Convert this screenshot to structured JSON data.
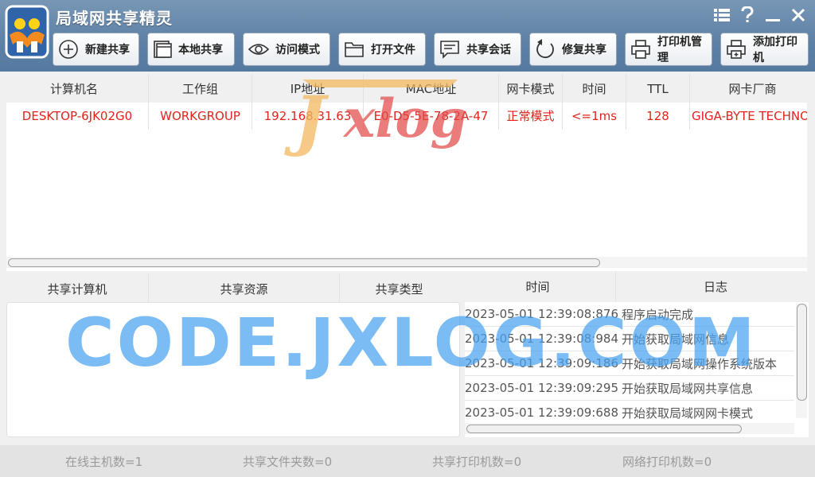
{
  "window": {
    "title": "局域网共享精灵"
  },
  "toolbar": {
    "buttons": [
      {
        "label": "新建共享",
        "icon": "plus-circle-icon"
      },
      {
        "label": "本地共享",
        "icon": "windows-icon"
      },
      {
        "label": "访问模式",
        "icon": "eye-icon"
      },
      {
        "label": "打开文件",
        "icon": "folder-icon"
      },
      {
        "label": "共享会话",
        "icon": "chat-icon"
      },
      {
        "label": "修复共享",
        "icon": "refresh-icon"
      },
      {
        "label": "打印机管理",
        "icon": "printer-icon"
      },
      {
        "label": "添加打印机",
        "icon": "printer-add-icon"
      }
    ]
  },
  "hosts": {
    "columns": [
      "计算机名",
      "工作组",
      "IP地址",
      "MAC地址",
      "网卡模式",
      "时间",
      "TTL",
      "网卡厂商"
    ],
    "rows": [
      [
        "DESKTOP-6JK02G0",
        "WORKGROUP",
        "192.168.31.63",
        "E0-D5-5E-78-2A-47",
        "正常模式",
        "<=1ms",
        "128",
        "GIGA-BYTE TECHNO"
      ]
    ]
  },
  "shares": {
    "columns": [
      "共享计算机",
      "共享资源",
      "共享类型"
    ]
  },
  "log": {
    "columns": [
      "时间",
      "日志"
    ],
    "entries": [
      {
        "time": "2023-05-01 12:39:08:876",
        "text": "程序启动完成"
      },
      {
        "time": "2023-05-01 12:39:08:984",
        "text": "开始获取局域网信息"
      },
      {
        "time": "2023-05-01 12:39:09:186",
        "text": "开始获取局域网操作系统版本"
      },
      {
        "time": "2023-05-01 12:39:09:295",
        "text": "开始获取局域网共享信息"
      },
      {
        "time": "2023-05-01 12:39:09:688",
        "text": "开始获取局域网网卡模式"
      }
    ]
  },
  "status": {
    "online_hosts": "在线主机数=1",
    "shared_folders": "共享文件夹数=0",
    "shared_printers": "共享打印机数=0",
    "network_printers": "网络打印机数=0"
  },
  "watermarks": {
    "logo_text": "Jxlog",
    "site": "CODE.JXLOG.COM"
  },
  "colors": {
    "title_bar": "#5f82a6",
    "row_text": "#e0241b",
    "watermark_blue": "#4aa3f0"
  }
}
